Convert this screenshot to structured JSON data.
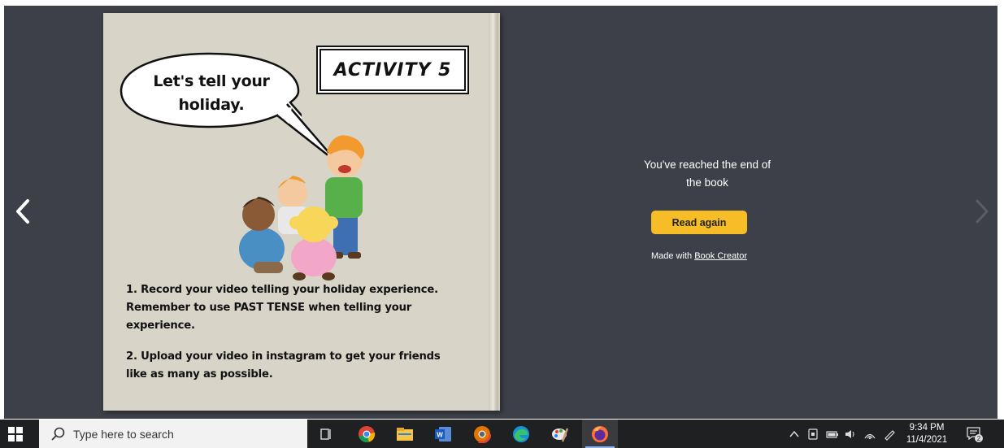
{
  "book_page": {
    "speech_bubble": [
      "Let's tell your",
      "holiday."
    ],
    "activity_title": "ACTIVITY 5",
    "instruction_1": [
      "1. Record your video telling your holiday experience.",
      "Remember to use PAST TENSE when telling your",
      "experience."
    ],
    "instruction_2": [
      "2. Upload your video in instagram to get your friends",
      "like as many as possible."
    ]
  },
  "end_panel": {
    "message_line1": "You've reached the end of",
    "message_line2": "the book",
    "read_again_label": "Read again",
    "made_with_prefix": "Made with ",
    "made_with_link": "Book Creator"
  },
  "navigation": {
    "prev_icon": "chevron-left-icon",
    "next_icon": "chevron-right-icon"
  },
  "taskbar": {
    "search_placeholder": "Type here to search",
    "pinned_apps": [
      "task-view-icon",
      "chrome-icon",
      "file-explorer-icon",
      "word-icon",
      "chrome-canary-icon",
      "edge-icon",
      "paint-icon",
      "firefox-icon"
    ],
    "time": "9:34 PM",
    "date": "11/4/2021",
    "notification_count": "2"
  },
  "colors": {
    "viewer_bg": "#3d4049",
    "page_bg": "#d8d4c8",
    "button_accent": "#f6bd26",
    "taskbar_bg": "#1f2022"
  }
}
